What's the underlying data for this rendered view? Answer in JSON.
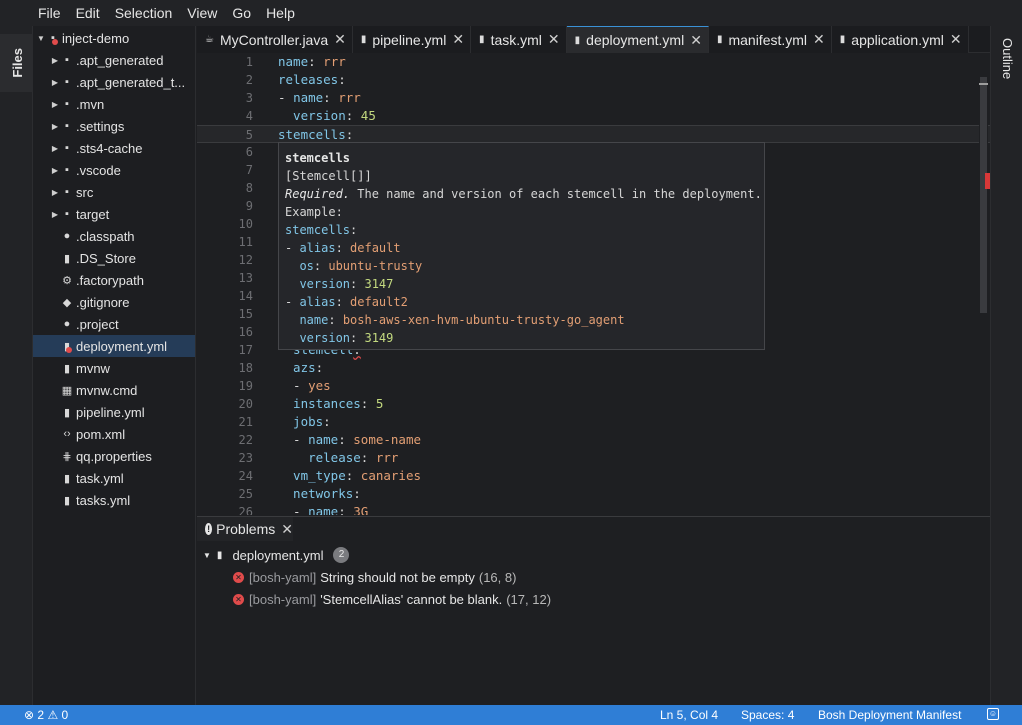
{
  "menu": [
    "File",
    "Edit",
    "Selection",
    "View",
    "Go",
    "Help"
  ],
  "left_panel_label": "Files",
  "right_panel_label": "Outline",
  "tree": [
    {
      "label": "inject-demo",
      "level": 0,
      "chevron": "down",
      "icon": "folder-icon",
      "glyph": "▪",
      "error": true
    },
    {
      "label": ".apt_generated",
      "level": 1,
      "chevron": "right",
      "icon": "folder-icon",
      "glyph": "▪"
    },
    {
      "label": ".apt_generated_t...",
      "level": 1,
      "chevron": "right",
      "icon": "folder-icon",
      "glyph": "▪"
    },
    {
      "label": ".mvn",
      "level": 1,
      "chevron": "right",
      "icon": "folder-icon",
      "glyph": "▪"
    },
    {
      "label": ".settings",
      "level": 1,
      "chevron": "right",
      "icon": "folder-icon",
      "glyph": "▪"
    },
    {
      "label": ".sts4-cache",
      "level": 1,
      "chevron": "right",
      "icon": "folder-icon",
      "glyph": "▪"
    },
    {
      "label": ".vscode",
      "level": 1,
      "chevron": "right",
      "icon": "folder-icon",
      "glyph": "▪"
    },
    {
      "label": "src",
      "level": 1,
      "chevron": "right",
      "icon": "folder-icon",
      "glyph": "▪"
    },
    {
      "label": "target",
      "level": 1,
      "chevron": "right",
      "icon": "folder-icon",
      "glyph": "▪"
    },
    {
      "label": ".classpath",
      "level": 1,
      "chevron": "",
      "icon": "file-circle-icon",
      "glyph": "●"
    },
    {
      "label": ".DS_Store",
      "level": 1,
      "chevron": "",
      "icon": "file-icon",
      "glyph": "▮"
    },
    {
      "label": ".factorypath",
      "level": 1,
      "chevron": "",
      "icon": "gear-icon",
      "glyph": "⚙"
    },
    {
      "label": ".gitignore",
      "level": 1,
      "chevron": "",
      "icon": "git-icon",
      "glyph": "◆"
    },
    {
      "label": ".project",
      "level": 1,
      "chevron": "",
      "icon": "file-circle-icon",
      "glyph": "●"
    },
    {
      "label": "deployment.yml",
      "level": 1,
      "chevron": "",
      "icon": "database-icon",
      "glyph": "▮",
      "selected": true,
      "error": true
    },
    {
      "label": "mvnw",
      "level": 1,
      "chevron": "",
      "icon": "file-icon",
      "glyph": "▮"
    },
    {
      "label": "mvnw.cmd",
      "level": 1,
      "chevron": "",
      "icon": "windows-icon",
      "glyph": "▦"
    },
    {
      "label": "pipeline.yml",
      "level": 1,
      "chevron": "",
      "icon": "database-icon",
      "glyph": "▮"
    },
    {
      "label": "pom.xml",
      "level": 1,
      "chevron": "",
      "icon": "code-icon",
      "glyph": "‹›"
    },
    {
      "label": "qq.properties",
      "level": 1,
      "chevron": "",
      "icon": "settings-lines-icon",
      "glyph": "⋕"
    },
    {
      "label": "task.yml",
      "level": 1,
      "chevron": "",
      "icon": "database-icon",
      "glyph": "▮"
    },
    {
      "label": "tasks.yml",
      "level": 1,
      "chevron": "",
      "icon": "database-icon",
      "glyph": "▮"
    }
  ],
  "tabs": [
    {
      "label": "MyController.java",
      "icon": "java-icon",
      "glyph": "☕",
      "active": false
    },
    {
      "label": "pipeline.yml",
      "icon": "database-icon",
      "glyph": "▮",
      "active": false
    },
    {
      "label": "task.yml",
      "icon": "database-icon",
      "glyph": "▮",
      "active": false
    },
    {
      "label": "deployment.yml",
      "icon": "database-icon",
      "glyph": "▮",
      "active": true
    },
    {
      "label": "manifest.yml",
      "icon": "database-icon",
      "glyph": "▮",
      "active": false
    },
    {
      "label": "application.yml",
      "icon": "database-icon",
      "glyph": "▮",
      "active": false
    }
  ],
  "tab_close_glyph": "✕",
  "editor_lines": [
    {
      "n": "1",
      "parts": [
        {
          "t": "name",
          "c": "k"
        },
        {
          "t": ": ",
          "c": "p"
        },
        {
          "t": "rrr",
          "c": "v"
        }
      ]
    },
    {
      "n": "2",
      "parts": [
        {
          "t": "releases",
          "c": "k"
        },
        {
          "t": ":",
          "c": "p"
        }
      ]
    },
    {
      "n": "3",
      "parts": [
        {
          "t": "- ",
          "c": "p"
        },
        {
          "t": "name",
          "c": "k"
        },
        {
          "t": ": ",
          "c": "p"
        },
        {
          "t": "rrr",
          "c": "v"
        }
      ]
    },
    {
      "n": "4",
      "parts": [
        {
          "t": "  version",
          "c": "k"
        },
        {
          "t": ": ",
          "c": "p"
        },
        {
          "t": "45",
          "c": "n"
        }
      ]
    },
    {
      "n": "5",
      "parts": [
        {
          "t": "stemcells",
          "c": "k"
        },
        {
          "t": ":",
          "c": "p"
        }
      ],
      "current": true
    },
    {
      "n": "6",
      "parts": []
    },
    {
      "n": "7",
      "parts": []
    },
    {
      "n": "8",
      "parts": []
    },
    {
      "n": "9",
      "parts": []
    },
    {
      "n": "10",
      "parts": []
    },
    {
      "n": "11",
      "parts": []
    },
    {
      "n": "12",
      "parts": []
    },
    {
      "n": "13",
      "parts": []
    },
    {
      "n": "14",
      "parts": []
    },
    {
      "n": "15",
      "parts": []
    },
    {
      "n": "16",
      "parts": []
    },
    {
      "n": "17",
      "parts": [
        {
          "t": "  stemcell",
          "c": "k"
        },
        {
          "t": ":",
          "c": "p squiggle"
        }
      ]
    },
    {
      "n": "18",
      "parts": [
        {
          "t": "  azs",
          "c": "k"
        },
        {
          "t": ":",
          "c": "p"
        }
      ]
    },
    {
      "n": "19",
      "parts": [
        {
          "t": "  - ",
          "c": "p"
        },
        {
          "t": "yes",
          "c": "v"
        }
      ]
    },
    {
      "n": "20",
      "parts": [
        {
          "t": "  instances",
          "c": "k"
        },
        {
          "t": ": ",
          "c": "p"
        },
        {
          "t": "5",
          "c": "n"
        }
      ]
    },
    {
      "n": "21",
      "parts": [
        {
          "t": "  jobs",
          "c": "k"
        },
        {
          "t": ":",
          "c": "p"
        }
      ]
    },
    {
      "n": "22",
      "parts": [
        {
          "t": "  - ",
          "c": "p"
        },
        {
          "t": "name",
          "c": "k"
        },
        {
          "t": ": ",
          "c": "p"
        },
        {
          "t": "some-name",
          "c": "v"
        }
      ]
    },
    {
      "n": "23",
      "parts": [
        {
          "t": "    release",
          "c": "k"
        },
        {
          "t": ": ",
          "c": "p"
        },
        {
          "t": "rrr",
          "c": "v"
        }
      ]
    },
    {
      "n": "24",
      "parts": [
        {
          "t": "  vm_type",
          "c": "k"
        },
        {
          "t": ": ",
          "c": "p"
        },
        {
          "t": "canaries",
          "c": "v"
        }
      ]
    },
    {
      "n": "25",
      "parts": [
        {
          "t": "  networks",
          "c": "k"
        },
        {
          "t": ":",
          "c": "p"
        }
      ]
    },
    {
      "n": "26",
      "parts": [
        {
          "t": "  - ",
          "c": "p"
        },
        {
          "t": "name",
          "c": "k"
        },
        {
          "t": ": ",
          "c": "p"
        },
        {
          "t": "3G",
          "c": "v"
        }
      ]
    }
  ],
  "hover": {
    "lines": [
      {
        "parts": [
          {
            "t": "stemcells",
            "c": "bold"
          }
        ]
      },
      {
        "parts": [
          {
            "t": "[Stemcell[]]",
            "c": "p"
          }
        ]
      },
      {
        "parts": [
          {
            "t": "Required.",
            "c": "ital"
          },
          {
            "t": " The name and version of each stemcell in the deployment.",
            "c": "p"
          }
        ]
      },
      {
        "parts": [
          {
            "t": "Example:",
            "c": "p"
          }
        ]
      },
      {
        "parts": [
          {
            "t": "stemcells",
            "c": "k"
          },
          {
            "t": ":",
            "c": "p"
          }
        ]
      },
      {
        "parts": [
          {
            "t": "- ",
            "c": "p"
          },
          {
            "t": "alias",
            "c": "k"
          },
          {
            "t": ": ",
            "c": "p"
          },
          {
            "t": "default",
            "c": "v"
          }
        ]
      },
      {
        "parts": [
          {
            "t": "  os",
            "c": "k"
          },
          {
            "t": ": ",
            "c": "p"
          },
          {
            "t": "ubuntu-trusty",
            "c": "v"
          }
        ]
      },
      {
        "parts": [
          {
            "t": "  version",
            "c": "k"
          },
          {
            "t": ": ",
            "c": "p"
          },
          {
            "t": "3147",
            "c": "n"
          }
        ]
      },
      {
        "parts": [
          {
            "t": "- ",
            "c": "p"
          },
          {
            "t": "alias",
            "c": "k"
          },
          {
            "t": ": ",
            "c": "p"
          },
          {
            "t": "default2",
            "c": "v"
          }
        ]
      },
      {
        "parts": [
          {
            "t": "  name",
            "c": "k"
          },
          {
            "t": ": ",
            "c": "p"
          },
          {
            "t": "bosh-aws-xen-hvm-ubuntu-trusty-go_agent",
            "c": "v"
          }
        ]
      },
      {
        "parts": [
          {
            "t": "  version",
            "c": "k"
          },
          {
            "t": ": ",
            "c": "p"
          },
          {
            "t": "3149",
            "c": "n"
          }
        ]
      }
    ]
  },
  "problems": {
    "tab_label": "Problems",
    "file": "deployment.yml",
    "count": "2",
    "items": [
      {
        "source": "[bosh-yaml]",
        "message": "String should not be empty",
        "position": "(16, 8)"
      },
      {
        "source": "[bosh-yaml]",
        "message": "'StemcellAlias' cannot be blank.",
        "position": "(17, 12)"
      }
    ]
  },
  "status": {
    "errors": "2",
    "warnings": "0",
    "cursor": "Ln 5, Col 4",
    "spaces": "Spaces: 4",
    "language": "Bosh Deployment Manifest"
  },
  "colors": {
    "accent": "#2f7ed6",
    "error": "#e04b4b",
    "key": "#81c6e7",
    "string": "#e39f74",
    "number": "#c3d97f"
  }
}
